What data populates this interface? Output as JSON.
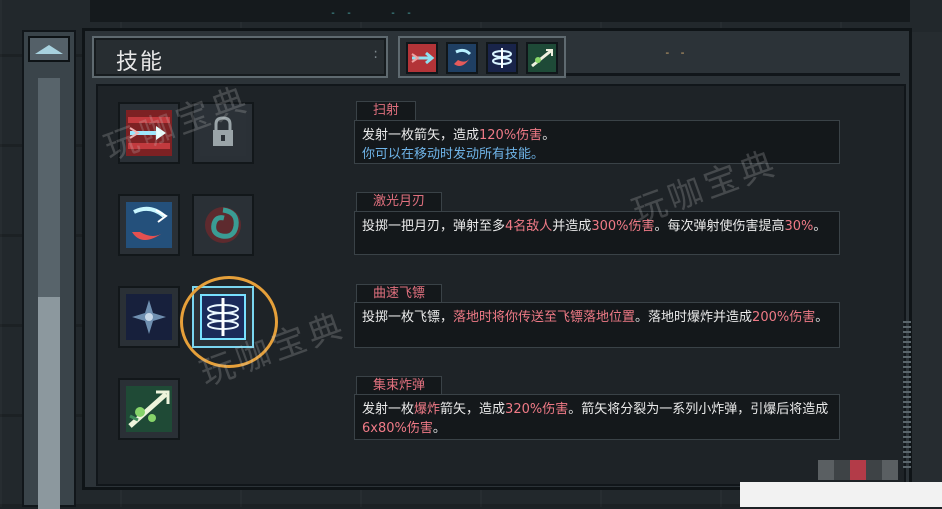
{
  "header": {
    "title": "技能",
    "dashes": "- -"
  },
  "top_dots": [
    "- -",
    "- -"
  ],
  "tabs": [
    {
      "name": "arrow-tab-icon",
      "color": "#c8383c"
    },
    {
      "name": "moon-blade-tab-icon",
      "color": "#3a7aa6"
    },
    {
      "name": "boomerang-tab-icon",
      "color": "#22305a"
    },
    {
      "name": "bomb-arrow-tab-icon",
      "color": "#2c6b4e"
    }
  ],
  "skills": [
    {
      "name": "扫射",
      "line1_pre": "发射一枚箭矢，造成",
      "line1_hl": "120%伤害",
      "line1_post": "。",
      "line2": "你可以在移动时发动所有技能。"
    },
    {
      "name": "激光月刃",
      "line1_pre": "投掷一把月刃，弹射至多",
      "line1_hl": "4名敌人",
      "line1_mid": "并造成",
      "line1_hl2": "300%伤害",
      "line1_post": "。每次弹射使伤害提高",
      "line1_hl3": "30%",
      "line1_end": "。"
    },
    {
      "name": "曲速飞镖",
      "line1_pre": "投掷一枚飞镖，",
      "line1_hl": "落地时将你传送至飞镖落地位置",
      "line1_mid": "。落地时爆炸并造成",
      "line1_hl2": "200%伤害",
      "line1_post": "。"
    },
    {
      "name": "集束炸弹",
      "line1_pre": "发射一枚",
      "line1_hl": "爆炸",
      "line1_mid": "箭矢，造成",
      "line1_hl2": "320%伤害",
      "line1_post": "。箭矢将分裂为一系列小炸弹，引爆后将造成",
      "line1_hl3": "6x80%伤害",
      "line1_end": "。"
    }
  ],
  "watermarks": [
    "玩咖宝典",
    "玩咖宝典",
    "玩咖宝典"
  ],
  "colors": {
    "highlight": "#ef7a86",
    "note": "#6fb4e8",
    "circle": "#e6a03a"
  }
}
